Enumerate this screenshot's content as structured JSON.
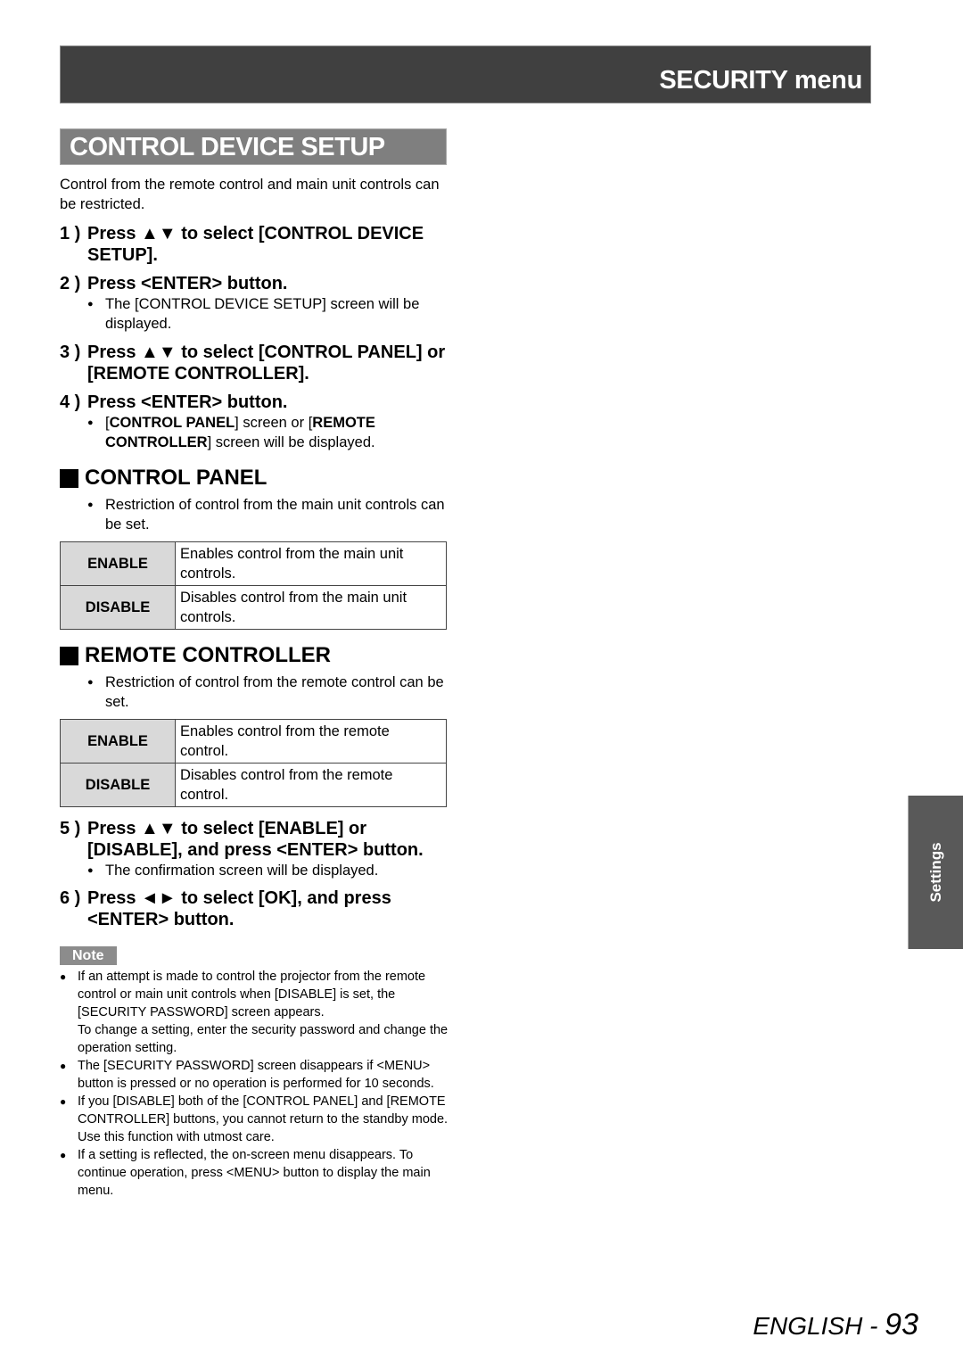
{
  "header": {
    "title": "SECURITY menu"
  },
  "section": {
    "title": "CONTROL DEVICE SETUP",
    "intro": "Control from the remote control and main unit controls can be restricted."
  },
  "steps_a": [
    {
      "num": "1 )",
      "text": "Press ▲▼ to select [CONTROL DEVICE SETUP].",
      "bullets": []
    },
    {
      "num": "2 )",
      "text": "Press <ENTER> button.",
      "bullets": [
        "The [CONTROL DEVICE SETUP] screen will be displayed."
      ]
    },
    {
      "num": "3 )",
      "text": "Press ▲▼ to select [CONTROL PANEL] or [REMOTE CONTROLLER].",
      "bullets": []
    },
    {
      "num": "4 )",
      "text": "Press <ENTER> button.",
      "bullets": []
    }
  ],
  "step4_bullet": {
    "b1": "CONTROL PANEL",
    "t1": "] screen or [",
    "b2": "REMOTE CONTROLLER",
    "t2": "] screen will be displayed.",
    "open": "["
  },
  "control_panel": {
    "title": "CONTROL PANEL",
    "bullet": "Restriction of control from the main unit controls can be set.",
    "options": [
      {
        "key": "ENABLE",
        "desc": "Enables control from the main unit controls."
      },
      {
        "key": "DISABLE",
        "desc": "Disables control from the main unit controls."
      }
    ]
  },
  "remote_controller": {
    "title": "REMOTE CONTROLLER",
    "bullet": "Restriction of control from the remote control can be set.",
    "options": [
      {
        "key": "ENABLE",
        "desc": "Enables control from the remote control."
      },
      {
        "key": "DISABLE",
        "desc": "Disables control from the remote control."
      }
    ]
  },
  "steps_b": [
    {
      "num": "5 )",
      "text": "Press ▲▼ to select [ENABLE] or [DISABLE], and press <ENTER> button.",
      "bullet": "The confirmation screen will be displayed."
    },
    {
      "num": "6 )",
      "text": "Press ◄► to select [OK], and press <ENTER> button."
    }
  ],
  "note": {
    "label": "Note",
    "items": [
      "If an attempt is made to control the projector from the remote control or main unit controls when [DISABLE] is set, the [SECURITY PASSWORD] screen appears.",
      "To change a setting, enter the security password and change the operation setting.",
      "The [SECURITY PASSWORD] screen disappears if <MENU> button is pressed or no operation is performed for 10 seconds.",
      "If you [DISABLE] both of the [CONTROL PANEL] and [REMOTE CONTROLLER] buttons, you cannot return to the standby mode. Use this function with utmost care.",
      "If a setting is reflected, the on-screen menu disappears. To continue operation, press <MENU> button to display the main menu."
    ]
  },
  "side_tab": {
    "label": "Settings"
  },
  "footer": {
    "language": "ENGLISH - ",
    "page": "93"
  },
  "bullet_glyph": "●"
}
